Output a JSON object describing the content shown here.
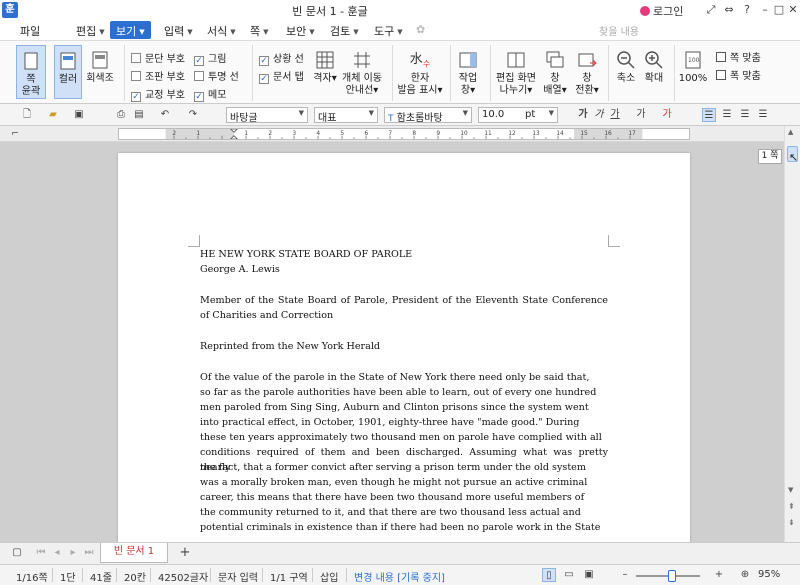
{
  "window": {
    "title": "빈 문서 1 - 훈글",
    "login": "로그인"
  },
  "menubar": {
    "items": [
      "파일",
      "편집",
      "보기",
      "입력",
      "서식",
      "쪽",
      "보안",
      "검토",
      "도구"
    ],
    "search_placeholder": "찾을 내용"
  },
  "ribbon": {
    "view_mode_buttons": [
      {
        "label1": "쪽",
        "label2": "윤곽"
      },
      {
        "label1": "컬러",
        "label2": ""
      },
      {
        "label1": "회색조",
        "label2": ""
      }
    ],
    "checkboxes_col1": [
      {
        "label": "문단 부호",
        "checked": false
      },
      {
        "label": "조판 부호",
        "checked": false
      },
      {
        "label": "교정 부호",
        "checked": true
      }
    ],
    "checkboxes_col2": [
      {
        "label": "그림",
        "checked": true
      },
      {
        "label": "투명 선",
        "checked": false
      },
      {
        "label": "메모",
        "checked": true
      }
    ],
    "checkboxes_col3": [
      {
        "label": "상황 선",
        "checked": true
      },
      {
        "label": "문서 탭",
        "checked": true
      }
    ],
    "grid": "격자",
    "obj_move1": "개체 이동",
    "obj_move2": "안내선",
    "hanja1": "한자",
    "hanja2": "발음 표시",
    "work_window1": "작업",
    "work_window2": "창",
    "split1": "편집 화면",
    "split2": "나누기",
    "arrange1": "창",
    "arrange2": "배열",
    "switch1": "창",
    "switch2": "전환",
    "zoom_out": "축소",
    "zoom_in": "확대",
    "zoom_100": "100%",
    "fit_page": "쪽 맞춤",
    "fit_width": "폭 맞춤"
  },
  "format_toolbar": {
    "style": "바탕글",
    "lang": "대표",
    "font": "함초롬바탕",
    "size": "10.0",
    "unit": "pt",
    "bold": "가",
    "italic": "가",
    "underline": "가"
  },
  "page_tooltip": "1 쪽",
  "document": {
    "heading1": "HE NEW YORK STATE BOARD OF PAROLE",
    "heading2": "George A. Lewis",
    "para1": "Member of the State Board of Parole, President of the Eleventh State Conference of Charities and Correction",
    "para2": "Reprinted from the New York Herald",
    "lines": [
      "Of the value of the parole in the State of New York there need only be said that,",
      "so far as the parole authorities have been able to learn, out of every one hundred",
      "men paroled from Sing Sing, Auburn and Clinton prisons since the system went",
      "into practical effect, in October, 1901, eighty-three have \"made good.\" During",
      "these ten years approximately two thousand men on parole have complied with all",
      "conditions required of them and been discharged. Assuming what was pretty nearly",
      "the fact, that a former convict after serving a prison term under the old system",
      "was a morally broken man, even though he might not pursue an active criminal",
      "career, this means that there have been two thousand more useful members of",
      "the community returned to it, and that there are two thousand less actual and",
      "potential criminals in existence than if there had been no parole work in the State"
    ]
  },
  "tabs": {
    "doc_tab": "빈 문서 1",
    "add": "+"
  },
  "status": {
    "page": "1/16쪽",
    "section": "1단",
    "line": "41줄",
    "col": "20칸",
    "chars": "42502글자",
    "mode": "문자 입력",
    "area": "1/1 구역",
    "insert": "삽입",
    "track": "변경 내용 [기록 중지]",
    "zoom": "95%"
  },
  "colors": {
    "accent": "#2b6fd1",
    "tab_text": "#c03030",
    "zoom_slider": "#2b6fd1"
  }
}
